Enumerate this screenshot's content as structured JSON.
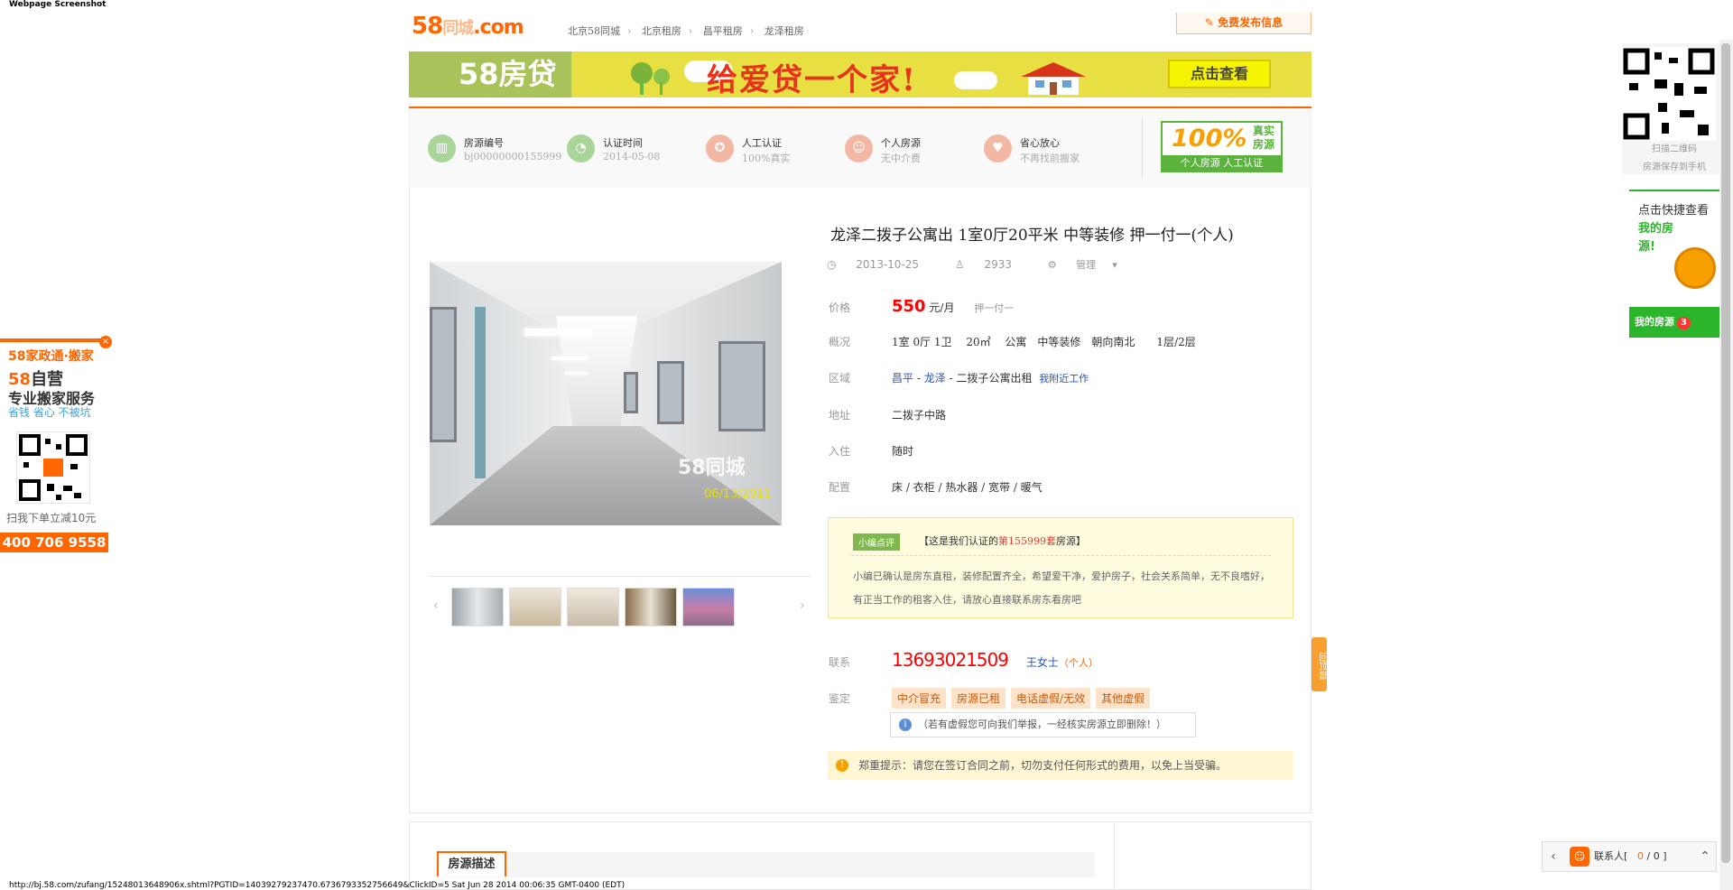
{
  "screenshot_caption": "Webpage Screenshot",
  "header": {
    "logo_text": "58",
    "logo_sub": "同城",
    "logo_com": ".com",
    "breadcrumbs": [
      "北京58同城",
      "北京租房",
      "昌平租房",
      "龙泽租房"
    ],
    "post_button": "免费发布信息"
  },
  "banner": {
    "brand": "58房贷",
    "slogan": "给爱贷一个家!",
    "cta": "点击查看"
  },
  "features": [
    {
      "title": "房源编号",
      "value": "bj00000000155999",
      "color": "#8dcf8a",
      "icon": "building-icon"
    },
    {
      "title": "认证时间",
      "value": "2014-05-08",
      "color": "#8dcf8a",
      "icon": "clock-icon"
    },
    {
      "title": "人工认证",
      "value": "100%真实",
      "color": "#f0a88f",
      "icon": "award-icon"
    },
    {
      "title": "个人房源",
      "value": "无中介费",
      "color": "#f0a88f",
      "icon": "person-icon"
    },
    {
      "title": "省心放心",
      "value": "不再找前搬家",
      "color": "#f0a88f",
      "icon": "heart-icon"
    }
  ],
  "badge": {
    "percent": "100%",
    "real1": "真实",
    "real2": "房源",
    "footer": "个人房源 人工认证"
  },
  "listing": {
    "title": "龙泽二拨子公寓出 1室0厅20平米 中等装修 押一付一(个人)",
    "date": "2013-10-25",
    "views": "2933",
    "manage": "管理",
    "price_label": "价格",
    "price": "550",
    "price_unit": "元/月",
    "deposit": "押一付一",
    "overview_label": "概况",
    "overview": "1室 0厅 1卫　 20㎡　 公寓　中等装修　朝向南北　　1层/2层",
    "area_label": "区域",
    "area_district": "昌平",
    "area_sub": "龙泽",
    "area_name": "二拨子公寓出租",
    "area_work": "我附近工作",
    "address_label": "地址",
    "address": "二拨子中路",
    "move_label": "入住",
    "move": "随时",
    "config_label": "配置",
    "config": "床 / 衣柜 / 热水器 / 宽带 / 暖气",
    "photo_watermark": "58同城",
    "photo_date": "06/13/2011"
  },
  "editor_note": {
    "tag": "小编点评",
    "header_pre": "【这是我们认证的",
    "header_num": "第155999套",
    "header_post": "房源】",
    "body": "小编已确认是房东直租，装修配置齐全，希望爱干净，爱护房子，社会关系简单，无不良嗜好，有正当工作的租客入住，请放心直接联系房东看房吧"
  },
  "contact": {
    "label": "联系",
    "phone": "13693021509",
    "name": "王女士",
    "type": "（个人）"
  },
  "verify": {
    "label": "鉴定",
    "tags": [
      "中介冒充",
      "房源已租",
      "电话虚假/无效",
      "其他虚假"
    ],
    "hint": "（若有虚假您可向我们举报，一经核实房源立即删除！）"
  },
  "warning": "郑重提示：请您在签订合同之前，切勿支付任何形式的费用，以免上当受骗。",
  "description_tab": "房源描述",
  "left_ad": {
    "line1": "58家政通·搬家",
    "line2_num": "58",
    "line2": "自营",
    "line3": "专业搬家服务",
    "line4": "省钱 省心 不被坑",
    "scan": "扫我下单立减10元",
    "phone": "400 706 9558",
    "close": "×"
  },
  "right_qr": {
    "line1": "扫描二维码",
    "line2": "房源保存到手机"
  },
  "right_panel": {
    "line1": "点击快捷查看",
    "line2": "我的房",
    "line3": "源!",
    "bottom": "我的房源",
    "count": "3"
  },
  "back_top": "回顶部",
  "chat": {
    "label": "联系人[",
    "count_a": "0",
    "count_sep": "/",
    "count_b": "0",
    "close": "]"
  },
  "status_bar": "http://bj.58.com/zufang/15248013648906x.shtml?PGTID=14039279237470.6736793352756649&ClickID=5 Sat Jun 28 2014 00:06:35 GMT-0400 (EDT)"
}
